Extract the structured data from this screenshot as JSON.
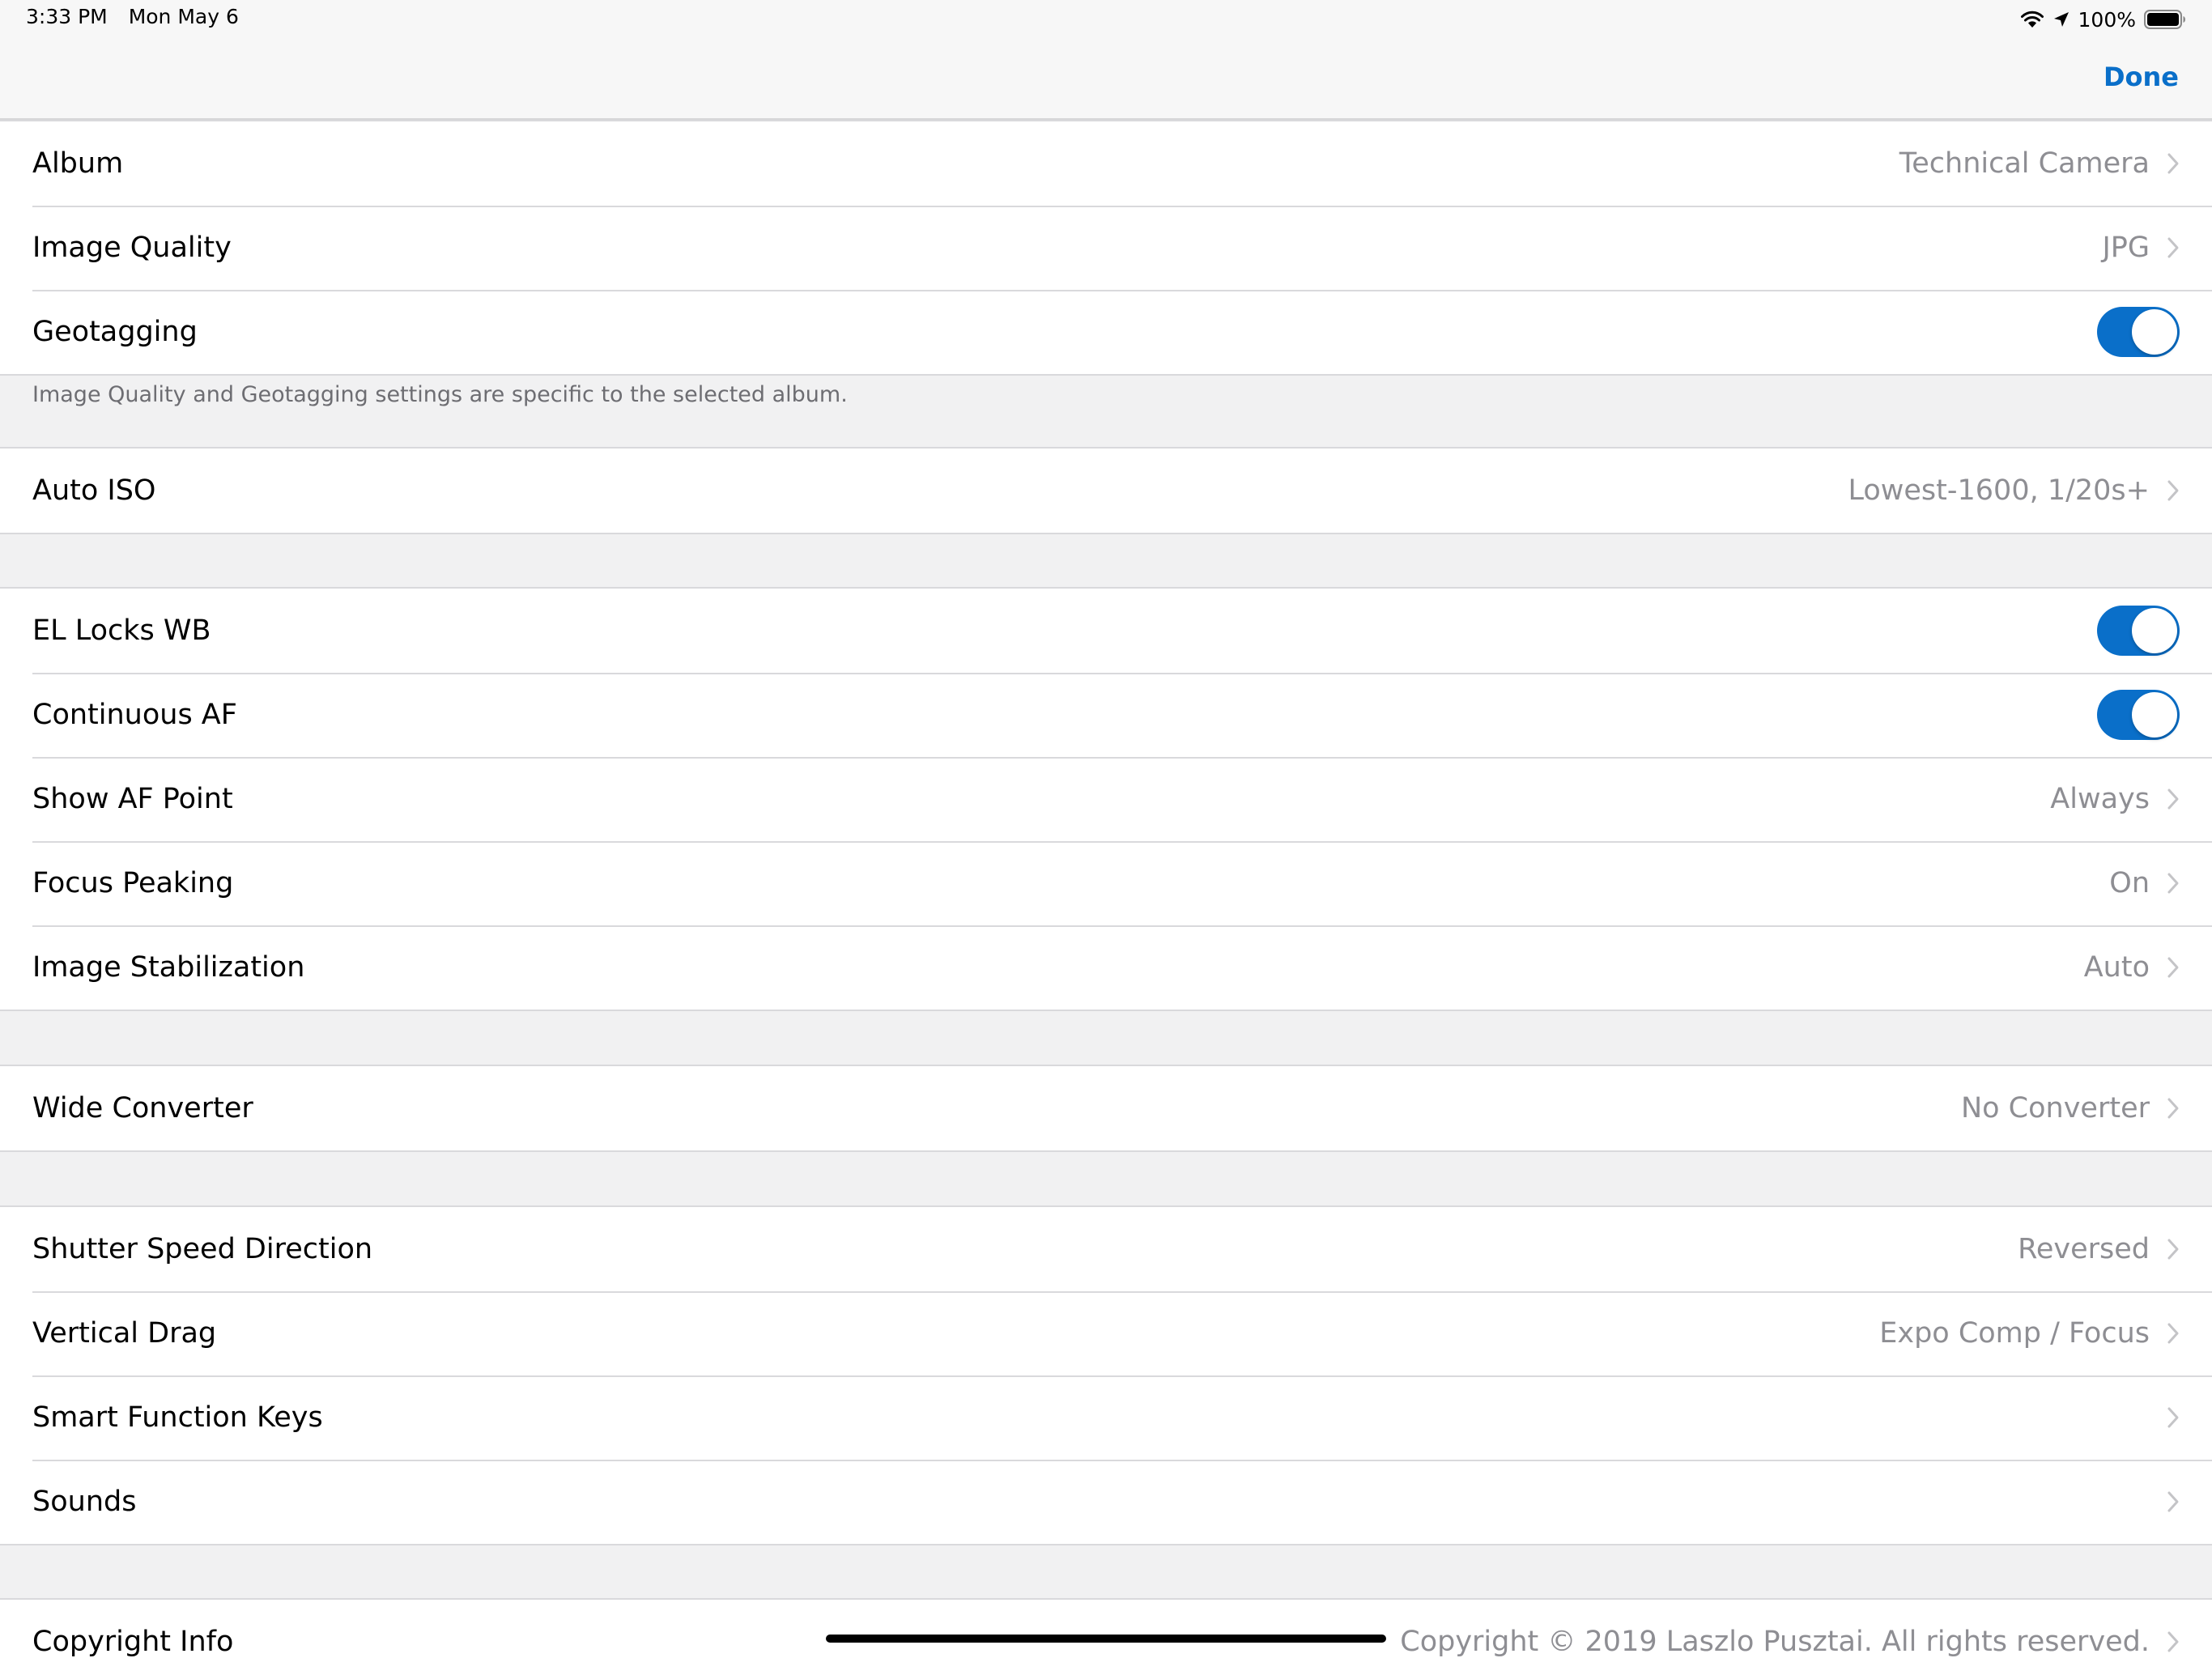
{
  "status_bar": {
    "time": "3:33 PM",
    "date": "Mon May 6",
    "battery_percent": "100%",
    "icons": [
      "wifi-icon",
      "location-icon",
      "battery-icon"
    ]
  },
  "nav": {
    "done_label": "Done"
  },
  "colors": {
    "accent": "#0a6fc9",
    "background": "#f1f1f2",
    "value_text": "#8e8e93"
  },
  "sections": {
    "album": {
      "rows": [
        {
          "label": "Album",
          "value": "Technical Camera",
          "accessory": "chevron"
        },
        {
          "label": "Image Quality",
          "value": "JPG",
          "accessory": "chevron"
        },
        {
          "label": "Geotagging",
          "toggle": true
        }
      ],
      "footer": "Image Quality and Geotagging settings are specific to the selected album."
    },
    "iso": {
      "rows": [
        {
          "label": "Auto ISO",
          "value": "Lowest-1600, 1/20s+",
          "accessory": "chevron"
        }
      ]
    },
    "focus": {
      "rows": [
        {
          "label": "EL Locks WB",
          "toggle": true
        },
        {
          "label": "Continuous AF",
          "toggle": true
        },
        {
          "label": "Show AF Point",
          "value": "Always",
          "accessory": "chevron"
        },
        {
          "label": "Focus Peaking",
          "value": "On",
          "accessory": "chevron"
        },
        {
          "label": "Image Stabilization",
          "value": "Auto",
          "accessory": "chevron"
        }
      ]
    },
    "converter": {
      "rows": [
        {
          "label": "Wide Converter",
          "value": "No Converter",
          "accessory": "chevron"
        }
      ]
    },
    "controls": {
      "rows": [
        {
          "label": "Shutter Speed Direction",
          "value": "Reversed",
          "accessory": "chevron"
        },
        {
          "label": "Vertical Drag",
          "value": "Expo Comp / Focus",
          "accessory": "chevron"
        },
        {
          "label": "Smart Function Keys",
          "value": "",
          "accessory": "chevron"
        },
        {
          "label": "Sounds",
          "value": "",
          "accessory": "chevron"
        }
      ]
    },
    "about": {
      "rows": [
        {
          "label": "Copyright Info",
          "value": "Copyright © 2019 Laszlo Pusztai. All rights reserved.",
          "accessory": "chevron"
        }
      ]
    }
  }
}
